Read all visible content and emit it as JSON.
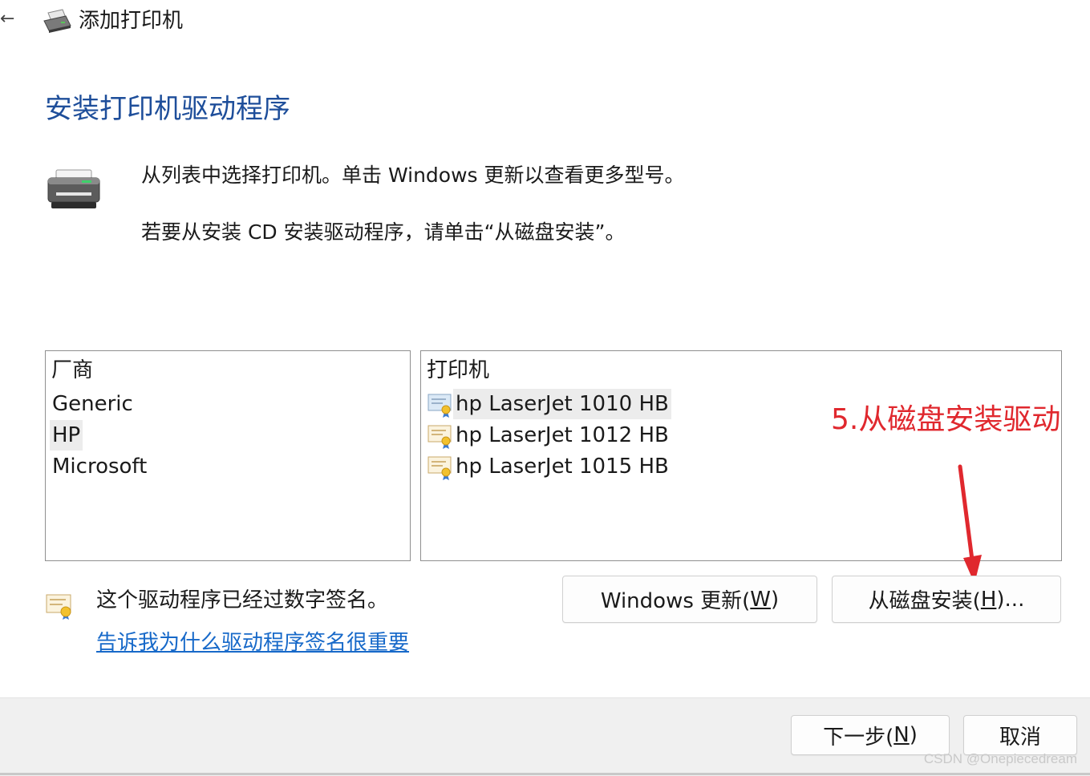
{
  "window": {
    "back_glyph": "←",
    "title": "添加打印机"
  },
  "heading": "安装打印机驱动程序",
  "description": {
    "line1": "从列表中选择打印机。单击 Windows 更新以查看更多型号。",
    "line2": "若要从安装 CD 安装驱动程序，请单击“从磁盘安装”。"
  },
  "manufacturers": {
    "header": "厂商",
    "items": [
      "Generic",
      "HP",
      "Microsoft"
    ],
    "selected": "HP"
  },
  "printers": {
    "header": "打印机",
    "items": [
      "hp LaserJet 1010 HB",
      "hp LaserJet 1012 HB",
      "hp LaserJet 1015 HB"
    ],
    "selected": "hp LaserJet 1010 HB"
  },
  "annotation": {
    "text": "5.从磁盘安装驱动",
    "color": "#e0282e"
  },
  "signature": {
    "text": "这个驱动程序已经过数字签名。",
    "link": "告诉我为什么驱动程序签名很重要"
  },
  "buttons": {
    "windows_update": {
      "prefix": "Windows 更新(",
      "key": "W",
      "suffix": ")"
    },
    "have_disk": {
      "prefix": "从磁盘安装(",
      "key": "H",
      "suffix": ")..."
    },
    "next": {
      "prefix": "下一步(",
      "key": "N",
      "suffix": ")"
    },
    "cancel": "取消"
  },
  "watermark": "CSDN @Onepiecedream",
  "colors": {
    "heading": "#1e4e9a",
    "link": "#1769c9",
    "annotation": "#e0282e"
  }
}
